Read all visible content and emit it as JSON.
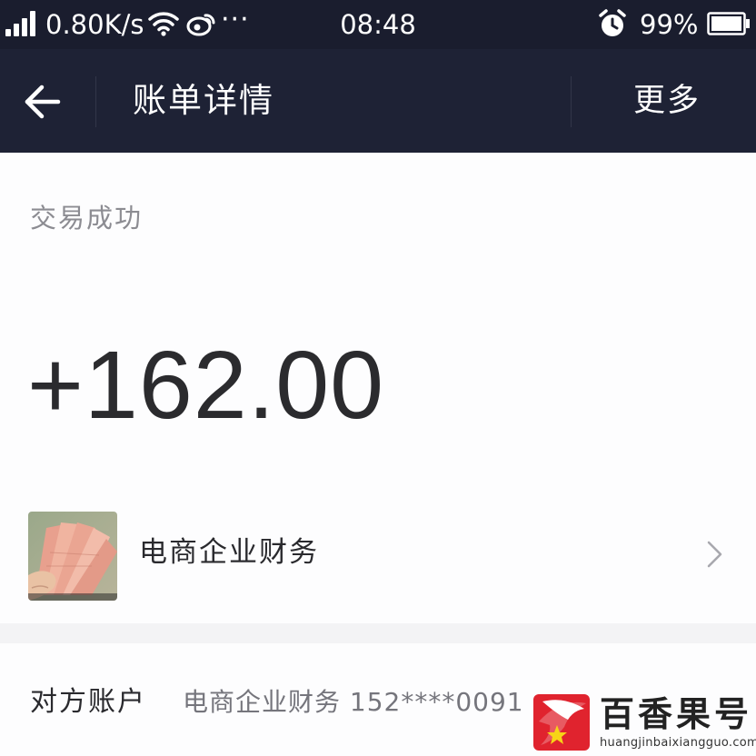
{
  "status_bar": {
    "network_speed": "0.80K/s",
    "more_indicator": "···",
    "time": "08:48",
    "battery_percent": "99%",
    "icons": [
      "signal-icon",
      "wifi-icon",
      "weibo-icon",
      "alarm-icon",
      "battery-icon"
    ]
  },
  "nav": {
    "back_icon": "back-arrow-icon",
    "title": "账单详情",
    "more_label": "更多"
  },
  "summary": {
    "status": "交易成功",
    "amount": "+162.00",
    "merchant_name": "电商企业财务",
    "chevron_icon": "chevron-right-icon"
  },
  "detail": {
    "label": "对方账户",
    "value": "电商企业财务 152****0091"
  },
  "watermark": {
    "text": "百香果号",
    "url": "huangjinbaixiangguo.com"
  },
  "colors": {
    "nav_background": "#1e2235",
    "status_bar_background": "#1a1d2e",
    "page_background": "#f3f3f5",
    "card_background": "#fdfdfe",
    "amount_color": "#2b2b2e",
    "watermark_red": "#e0232e"
  }
}
